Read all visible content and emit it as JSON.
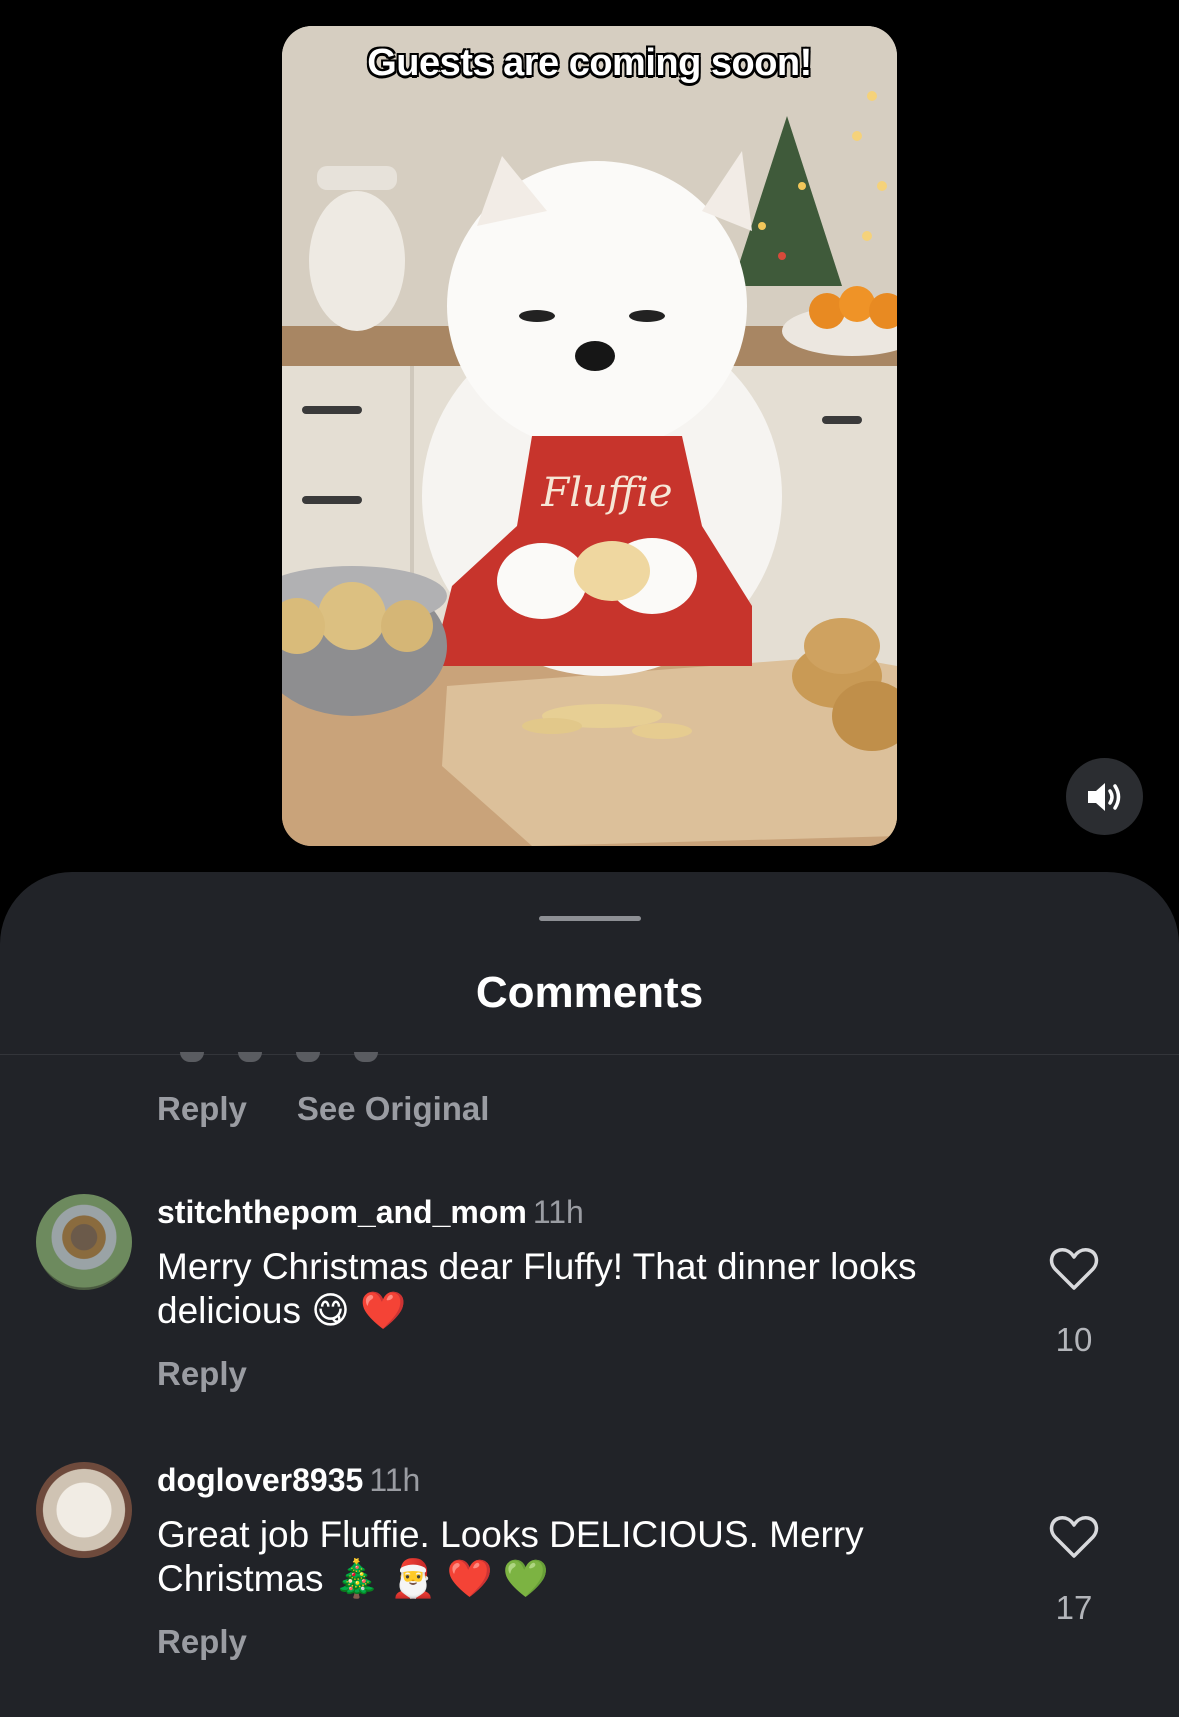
{
  "video": {
    "caption": "Guests are coming soon!",
    "apron_text": "Fluffie"
  },
  "sheet": {
    "title": "Comments"
  },
  "previous_comment": {
    "reply_label": "Reply",
    "see_original_label": "See Original"
  },
  "comments": [
    {
      "username": "stitchthepom_and_mom",
      "time": "11h",
      "text": "Merry Christmas dear Fluffy! That dinner looks delicious 😋 ❤️",
      "reply_label": "Reply",
      "likes": "10"
    },
    {
      "username": "doglover8935",
      "time": "11h",
      "text": "Great job Fluffie. Looks DELICIOUS. Merry Christmas 🎄 🎅 ❤️ 💚",
      "reply_label": "Reply",
      "likes": "17"
    }
  ],
  "colors": {
    "background": "#000000",
    "sheet": "#212328",
    "muted_text": "#9a9ca2",
    "apron": "#c7342c"
  }
}
